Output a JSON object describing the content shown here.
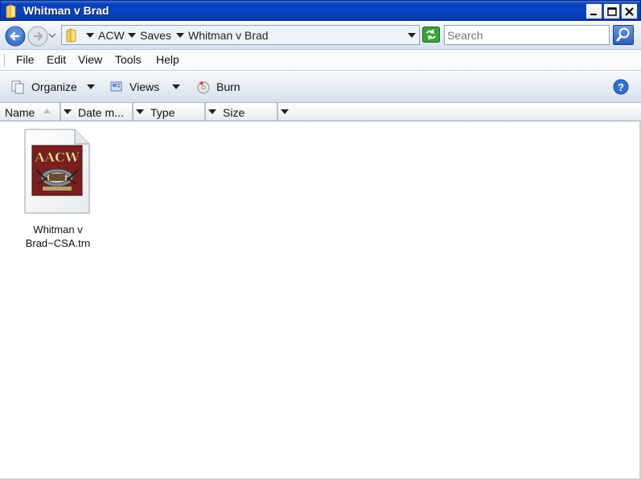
{
  "window": {
    "title": "Whitman v Brad",
    "controls": {
      "minimize": "minimize-icon",
      "maximize": "maximize-icon",
      "close": "close-icon"
    }
  },
  "address_bar": {
    "crumbs": [
      "ACW",
      "Saves",
      "Whitman v Brad"
    ]
  },
  "search": {
    "placeholder": "Search"
  },
  "menu": {
    "items": [
      "File",
      "Edit",
      "View",
      "Tools",
      "Help"
    ]
  },
  "command_bar": {
    "organize": "Organize",
    "views": "Views",
    "burn": "Burn"
  },
  "columns": [
    "Name",
    "Date m...",
    "Type",
    "Size"
  ],
  "files": [
    {
      "name": "Whitman v Brad~CSA.trn",
      "name_line1": "Whitman v",
      "name_line2": "Brad~CSA.trn",
      "thumb_text": "AACW"
    }
  ],
  "colors": {
    "titlebar": "#0645c9",
    "accent": "#2f5fc2",
    "thumb_bg": "#7a1e1e",
    "thumb_text": "#f0dca0"
  }
}
